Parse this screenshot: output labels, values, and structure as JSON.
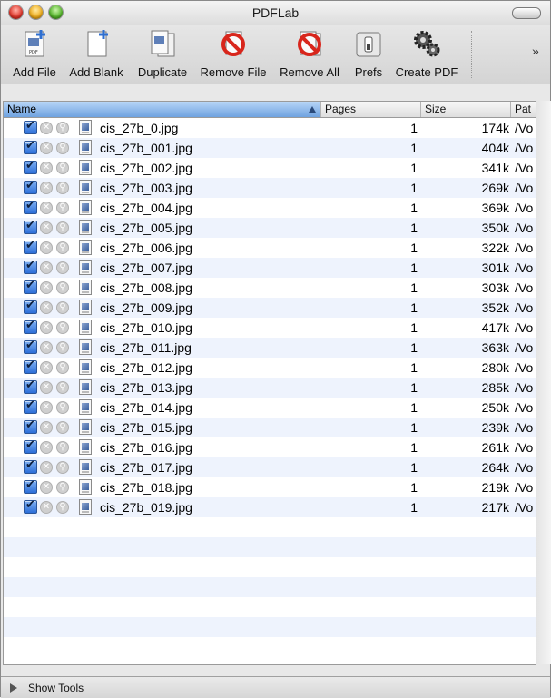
{
  "window": {
    "title": "PDFLab"
  },
  "toolbar": {
    "items": [
      {
        "label": "Add File",
        "icon": "add-file-icon"
      },
      {
        "label": "Add Blank",
        "icon": "add-blank-icon"
      },
      {
        "label": "Duplicate",
        "icon": "duplicate-icon"
      },
      {
        "label": "Remove File",
        "icon": "remove-file-icon"
      },
      {
        "label": "Remove All",
        "icon": "remove-all-icon"
      },
      {
        "label": "Prefs",
        "icon": "prefs-icon"
      },
      {
        "label": "Create PDF",
        "icon": "gears-icon"
      }
    ],
    "overflow": "»"
  },
  "table": {
    "columns": [
      "Name",
      "Pages",
      "Size",
      "Pat"
    ],
    "rows": [
      {
        "name": "cis_27b_0.jpg",
        "pages": "1",
        "size": "174k",
        "path": "/Vo"
      },
      {
        "name": "cis_27b_001.jpg",
        "pages": "1",
        "size": "404k",
        "path": "/Vo"
      },
      {
        "name": "cis_27b_002.jpg",
        "pages": "1",
        "size": "341k",
        "path": "/Vo"
      },
      {
        "name": "cis_27b_003.jpg",
        "pages": "1",
        "size": "269k",
        "path": "/Vo"
      },
      {
        "name": "cis_27b_004.jpg",
        "pages": "1",
        "size": "369k",
        "path": "/Vo"
      },
      {
        "name": "cis_27b_005.jpg",
        "pages": "1",
        "size": "350k",
        "path": "/Vo"
      },
      {
        "name": "cis_27b_006.jpg",
        "pages": "1",
        "size": "322k",
        "path": "/Vo"
      },
      {
        "name": "cis_27b_007.jpg",
        "pages": "1",
        "size": "301k",
        "path": "/Vo"
      },
      {
        "name": "cis_27b_008.jpg",
        "pages": "1",
        "size": "303k",
        "path": "/Vo"
      },
      {
        "name": "cis_27b_009.jpg",
        "pages": "1",
        "size": "352k",
        "path": "/Vo"
      },
      {
        "name": "cis_27b_010.jpg",
        "pages": "1",
        "size": "417k",
        "path": "/Vo"
      },
      {
        "name": "cis_27b_011.jpg",
        "pages": "1",
        "size": "363k",
        "path": "/Vo"
      },
      {
        "name": "cis_27b_012.jpg",
        "pages": "1",
        "size": "280k",
        "path": "/Vo"
      },
      {
        "name": "cis_27b_013.jpg",
        "pages": "1",
        "size": "285k",
        "path": "/Vo"
      },
      {
        "name": "cis_27b_014.jpg",
        "pages": "1",
        "size": "250k",
        "path": "/Vo"
      },
      {
        "name": "cis_27b_015.jpg",
        "pages": "1",
        "size": "239k",
        "path": "/Vo"
      },
      {
        "name": "cis_27b_016.jpg",
        "pages": "1",
        "size": "261k",
        "path": "/Vo"
      },
      {
        "name": "cis_27b_017.jpg",
        "pages": "1",
        "size": "264k",
        "path": "/Vo"
      },
      {
        "name": "cis_27b_018.jpg",
        "pages": "1",
        "size": "219k",
        "path": "/Vo"
      },
      {
        "name": "cis_27b_019.jpg",
        "pages": "1",
        "size": "217k",
        "path": "/Vo"
      }
    ]
  },
  "footer": {
    "show_tools_label": "Show Tools"
  },
  "colors": {
    "selection_header": "#6fa2e0",
    "row_alt": "#eef3fd",
    "checkbox": "#2c6fd8"
  }
}
